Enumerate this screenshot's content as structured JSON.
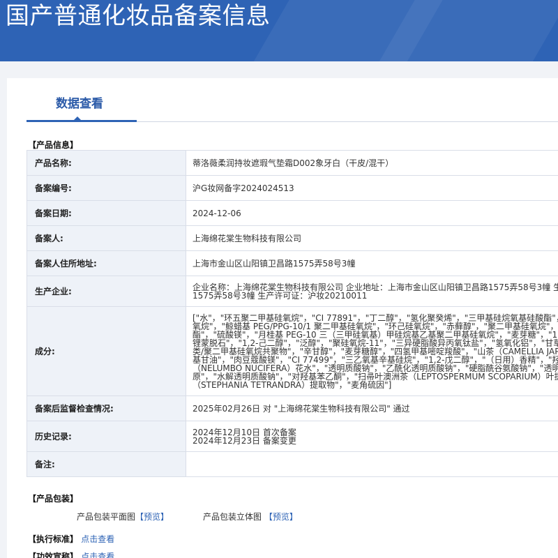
{
  "header": {
    "title": "国产普通化妆品备案信息"
  },
  "tabs": [
    {
      "label": "数据查看"
    }
  ],
  "product_info": {
    "section_title": "【产品信息】",
    "rows": [
      {
        "label": "产品名称:",
        "lines": [
          "蒂洛薇柔润持妆遮瑕气垫霜D002象牙白（干皮/混干）"
        ]
      },
      {
        "label": "备案编号:",
        "lines": [
          "沪G妆网备字2024024513"
        ]
      },
      {
        "label": "备案日期:",
        "lines": [
          "2024-12-06"
        ]
      },
      {
        "label": "备案人:",
        "lines": [
          "上海绵花棠生物科技有限公司"
        ]
      },
      {
        "label": "备案人住所地址:",
        "lines": [
          "上海市金山区山阳镇卫昌路1575弄58号3幢"
        ]
      },
      {
        "label": "生产企业:",
        "lines": [
          "企业名称：上海绵花棠生物科技有限公司 企业地址：上海市金山区山阳镇卫昌路1575弄58号3幢 生",
          "1575弄58号3幢 生产许可证：沪妆20210011"
        ]
      },
      {
        "label": "成分:",
        "lines": [
          "[\"水\"，\"环五聚二甲基硅氧烷\"，\"CI 77891\"，\"丁二醇\"，\"氢化聚癸烯\"，\"三甲基硅烷氧基硅酸酯\"，",
          "氧烷\"，\"鲸蜡基 PEG/PPG-10/1 聚二甲基硅氧烷\"，\"环己硅氧烷\"，\"赤藓醇\"，\"聚二甲基硅氧烷\"，",
          "酯\"，\"硫酸镁\"，\"月桂基 PEG-10 三（三甲硅氧基）甲硅烷基乙基聚二甲基硅氧烷\"，\"麦芽糖\"，\"1,",
          "锂蒙脱石\"，\"1,2-己二醇\"，\"泛醇\"，\"聚硅氧烷-11\"，\"三异硬脂酸异丙氧钛盐\"，\"氢氧化铝\"，\"甘草",
          "类/聚二甲基硅氧烷共聚物\"，\"辛甘醇\"，\"麦芽糖醇\"，\"四氢甲基嘧啶羧酸\"，\"山茶（CAMELLIA JAP",
          "基甘油\"，\"肉豆蔻酸镁\"，\"CI 77499\"，\"三乙氧基辛基硅烷\"，\"1,2-戊二醇\"，\"（日用）香精\"，\"羟",
          "（NELUMBO NUCIFERA）花水\"，\"透明质酸钠\"，\"乙酰化透明质酸钠\"，\"硬脂酰谷氨酸钠\"，\"透明",
          "原\"，\"水解透明质酸钠\"，\"对羟基苯乙酮\"，\"扫帚叶澳洲茶（LEPTOSPERMUM SCOPARIUM）叶提",
          "（STEPHANIA TETRANDRA）提取物\"，\"麦角硫因\"]"
        ]
      },
      {
        "label": "备案后监督检查情况:",
        "lines": [
          "2025年02月26日 对 \"上海绵花棠生物科技有限公司\" 通过"
        ]
      },
      {
        "label": "历史记录:",
        "lines": [
          "2024年12月10日 首次备案",
          "2024年12月23日 备案变更"
        ]
      },
      {
        "label": "备注:",
        "lines": [
          ""
        ]
      }
    ]
  },
  "packaging": {
    "section_title": "【产品包装】",
    "flat_label": "产品包装平面图",
    "flat_link": "【预览】",
    "stereo_label": "产品包装立体图",
    "stereo_link": "【预览】"
  },
  "standard": {
    "section_title": "【执行标准】",
    "link": "点击查看"
  },
  "efficacy": {
    "section_title": "【功效宣称】",
    "link": "点击查看"
  }
}
